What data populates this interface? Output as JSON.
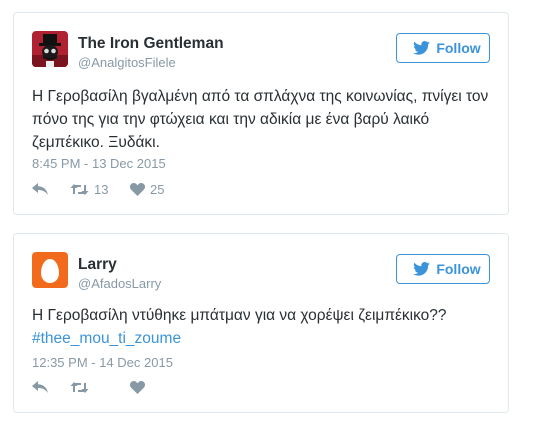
{
  "colors": {
    "accent": "#3b94d9",
    "text": "#292f33",
    "muted": "#8899a6",
    "border": "#e1e8ed",
    "avatar_larry_bg": "#f26a1b",
    "avatar_gentleman_bg": "#b02231"
  },
  "follow_icon": "twitter-bird-icon",
  "tweets": [
    {
      "user_name": "The Iron Gentleman",
      "handle": "@AnalgitosFilele",
      "avatar": "iron-gentleman-avatar",
      "follow_label": "Follow",
      "text": "Η Γεροβασίλη βγαλμένη από τα σπλάχνα της κοινωνίας, πνίγει τον πόνο της για την φτώχεια και την αδικία με ένα βαρύ λαικό ζεμπέκικο. Ξυδάκι.",
      "timestamp": "8:45 PM - 13 Dec 2015",
      "actions": {
        "reply_icon": "reply-icon",
        "retweet_icon": "retweet-icon",
        "retweet_count": "13",
        "like_icon": "heart-icon",
        "like_count": "25"
      }
    },
    {
      "user_name": "Larry",
      "handle": "@AfadosLarry",
      "avatar": "egg-avatar",
      "follow_label": "Follow",
      "text": "Η Γεροβασίλη ντύθηκε μπάτμαν για να χορέψει ζειμπέκικο??",
      "hashtag": "#thee_mou_ti_zoume",
      "timestamp": "12:35 PM - 14 Dec 2015",
      "actions": {
        "reply_icon": "reply-icon",
        "retweet_icon": "retweet-icon",
        "like_icon": "heart-icon"
      }
    }
  ]
}
